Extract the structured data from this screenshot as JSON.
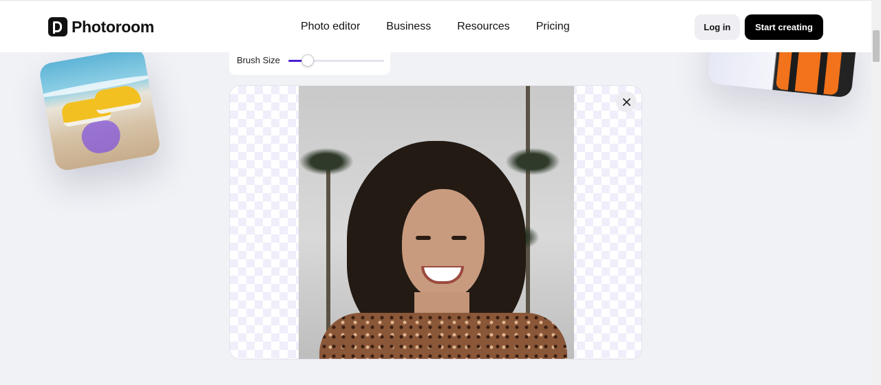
{
  "header": {
    "logo_text": "Photoroom",
    "nav": [
      "Photo editor",
      "Business",
      "Resources",
      "Pricing"
    ],
    "login_label": "Log in",
    "start_label": "Start creating"
  },
  "tool": {
    "brush_label": "Brush Size",
    "brush_value_fraction": 0.2
  },
  "canvas": {
    "close_icon": "close-icon"
  },
  "colors": {
    "accent": "#4a1fd0",
    "primary_button": "#000000",
    "background": "#f1f2f6"
  }
}
